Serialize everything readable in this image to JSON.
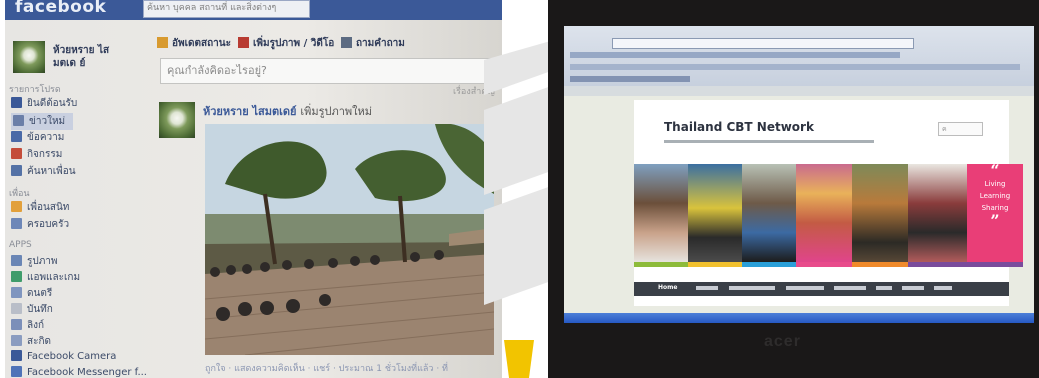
{
  "left_photo": {
    "fb_logo": "facebook",
    "search_placeholder": "ค้นหา บุคคล สถานที่ และสิ่งต่างๆ",
    "profile_name": "ห้วยหราย ไสมตเด ย์",
    "sidebar": {
      "favorites_header": "รายการโปรด",
      "items": [
        {
          "label": "ยินดีต้อนรับ",
          "icon": "facebook-icon",
          "color": "#3b5998"
        },
        {
          "label": "ข่าวใหม่",
          "icon": "news-feed-icon",
          "color": "#6b7fa8"
        },
        {
          "label": "ข้อความ",
          "icon": "messages-icon",
          "color": "#4a6aa7"
        },
        {
          "label": "กิจกรรม",
          "icon": "events-icon",
          "color": "#c44d3a"
        },
        {
          "label": "ค้นหาเพื่อน",
          "icon": "find-friends-icon",
          "color": "#5472a6"
        }
      ],
      "friends_header": "เพื่อน",
      "friend_items": [
        {
          "label": "เพื่อนสนิท",
          "icon": "close-friends-icon",
          "color": "#e2a03b"
        },
        {
          "label": "ครอบครัว",
          "icon": "family-icon",
          "color": "#6d87b8"
        }
      ],
      "apps_header": "APPS",
      "app_items": [
        {
          "label": "รูปภาพ",
          "icon": "photos-icon",
          "color": "#6a86b5"
        },
        {
          "label": "แอพและเกม",
          "icon": "games-icon",
          "color": "#3f9c6b"
        },
        {
          "label": "ดนตรี",
          "icon": "music-icon",
          "color": "#7f95bf"
        },
        {
          "label": "บันทึก",
          "icon": "notes-icon",
          "color": "#b9bec8"
        },
        {
          "label": "ลิงก์",
          "icon": "links-icon",
          "color": "#7b8fb9"
        },
        {
          "label": "สะกิด",
          "icon": "pokes-icon",
          "color": "#8a9cc0"
        },
        {
          "label": "Facebook Camera",
          "icon": "camera-icon",
          "color": "#3b5998"
        },
        {
          "label": "Facebook Messenger f...",
          "icon": "messenger-icon",
          "color": "#4f73b8"
        }
      ]
    },
    "composer": {
      "update_status": "อัพเดตสถานะ",
      "add_photo": "เพิ่มรูปภาพ / วิดีโอ",
      "ask_question": "ถามคำถาม",
      "placeholder": "คุณกำลังคิดอะไรอยู่?"
    },
    "sort_label": "เรื่องสำคัญ",
    "post": {
      "author": "ห้วยหราย ไสมตเดย์",
      "action": "เพิ่มรูปภาพใหม่",
      "footer": "ถูกใจ · แสดงความคิดเห็น · แชร์ · ประมาณ 1 ชั่วโมงที่แล้ว · ที่"
    }
  },
  "right_photo": {
    "site_title": "Thailand CBT Network",
    "search_placeholder": "ค",
    "quote_lines": [
      "Living",
      "Learning",
      "Sharing"
    ],
    "nav_home": "Home",
    "monitor_brand": "acer",
    "colors": {
      "quote_bg": "#e93e77",
      "nav_bg": "#3a3f47",
      "taskbar": "#2659c4"
    }
  }
}
